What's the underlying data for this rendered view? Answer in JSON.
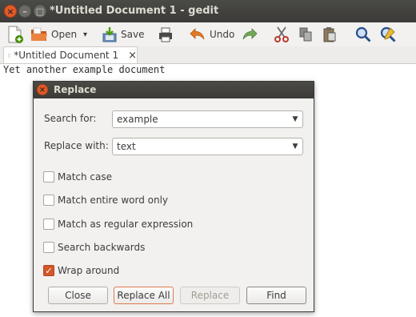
{
  "window": {
    "title": "*Untitled Document 1 - gedit",
    "controls": {
      "close": "×",
      "minimize": "–",
      "maximize": "□"
    }
  },
  "toolbar": {
    "new_icon": "new-document-icon",
    "open_label": "Open",
    "open_dropdown": "▾",
    "save_label": "Save",
    "print_icon": "print-icon",
    "undo_label": "Undo",
    "redo_icon": "redo-icon",
    "cut_icon": "cut-icon",
    "copy_icon": "copy-icon",
    "paste_icon": "paste-icon",
    "find_icon": "find-icon",
    "replace_icon": "find-replace-icon"
  },
  "tab": {
    "label": "*Untitled Document 1",
    "close": "×"
  },
  "editor": {
    "text": "Yet another example document"
  },
  "dialog": {
    "title": "Replace",
    "close": "×",
    "search_label": "Search for:",
    "search_value": "example",
    "replace_label": "Replace with:",
    "replace_value": "text",
    "options": [
      {
        "label": "Match case",
        "checked": false
      },
      {
        "label": "Match entire word only",
        "checked": false
      },
      {
        "label": "Match as regular expression",
        "checked": false
      },
      {
        "label": "Search backwards",
        "checked": false
      },
      {
        "label": "Wrap around",
        "checked": true
      }
    ],
    "check_mark": "✓",
    "buttons": {
      "close": "Close",
      "replace_all": "Replace All",
      "replace": "Replace",
      "find": "Find"
    }
  },
  "colors": {
    "accent": "#d2572b",
    "titlebar": "#3c3b37",
    "window_close": "#e15a2a"
  }
}
